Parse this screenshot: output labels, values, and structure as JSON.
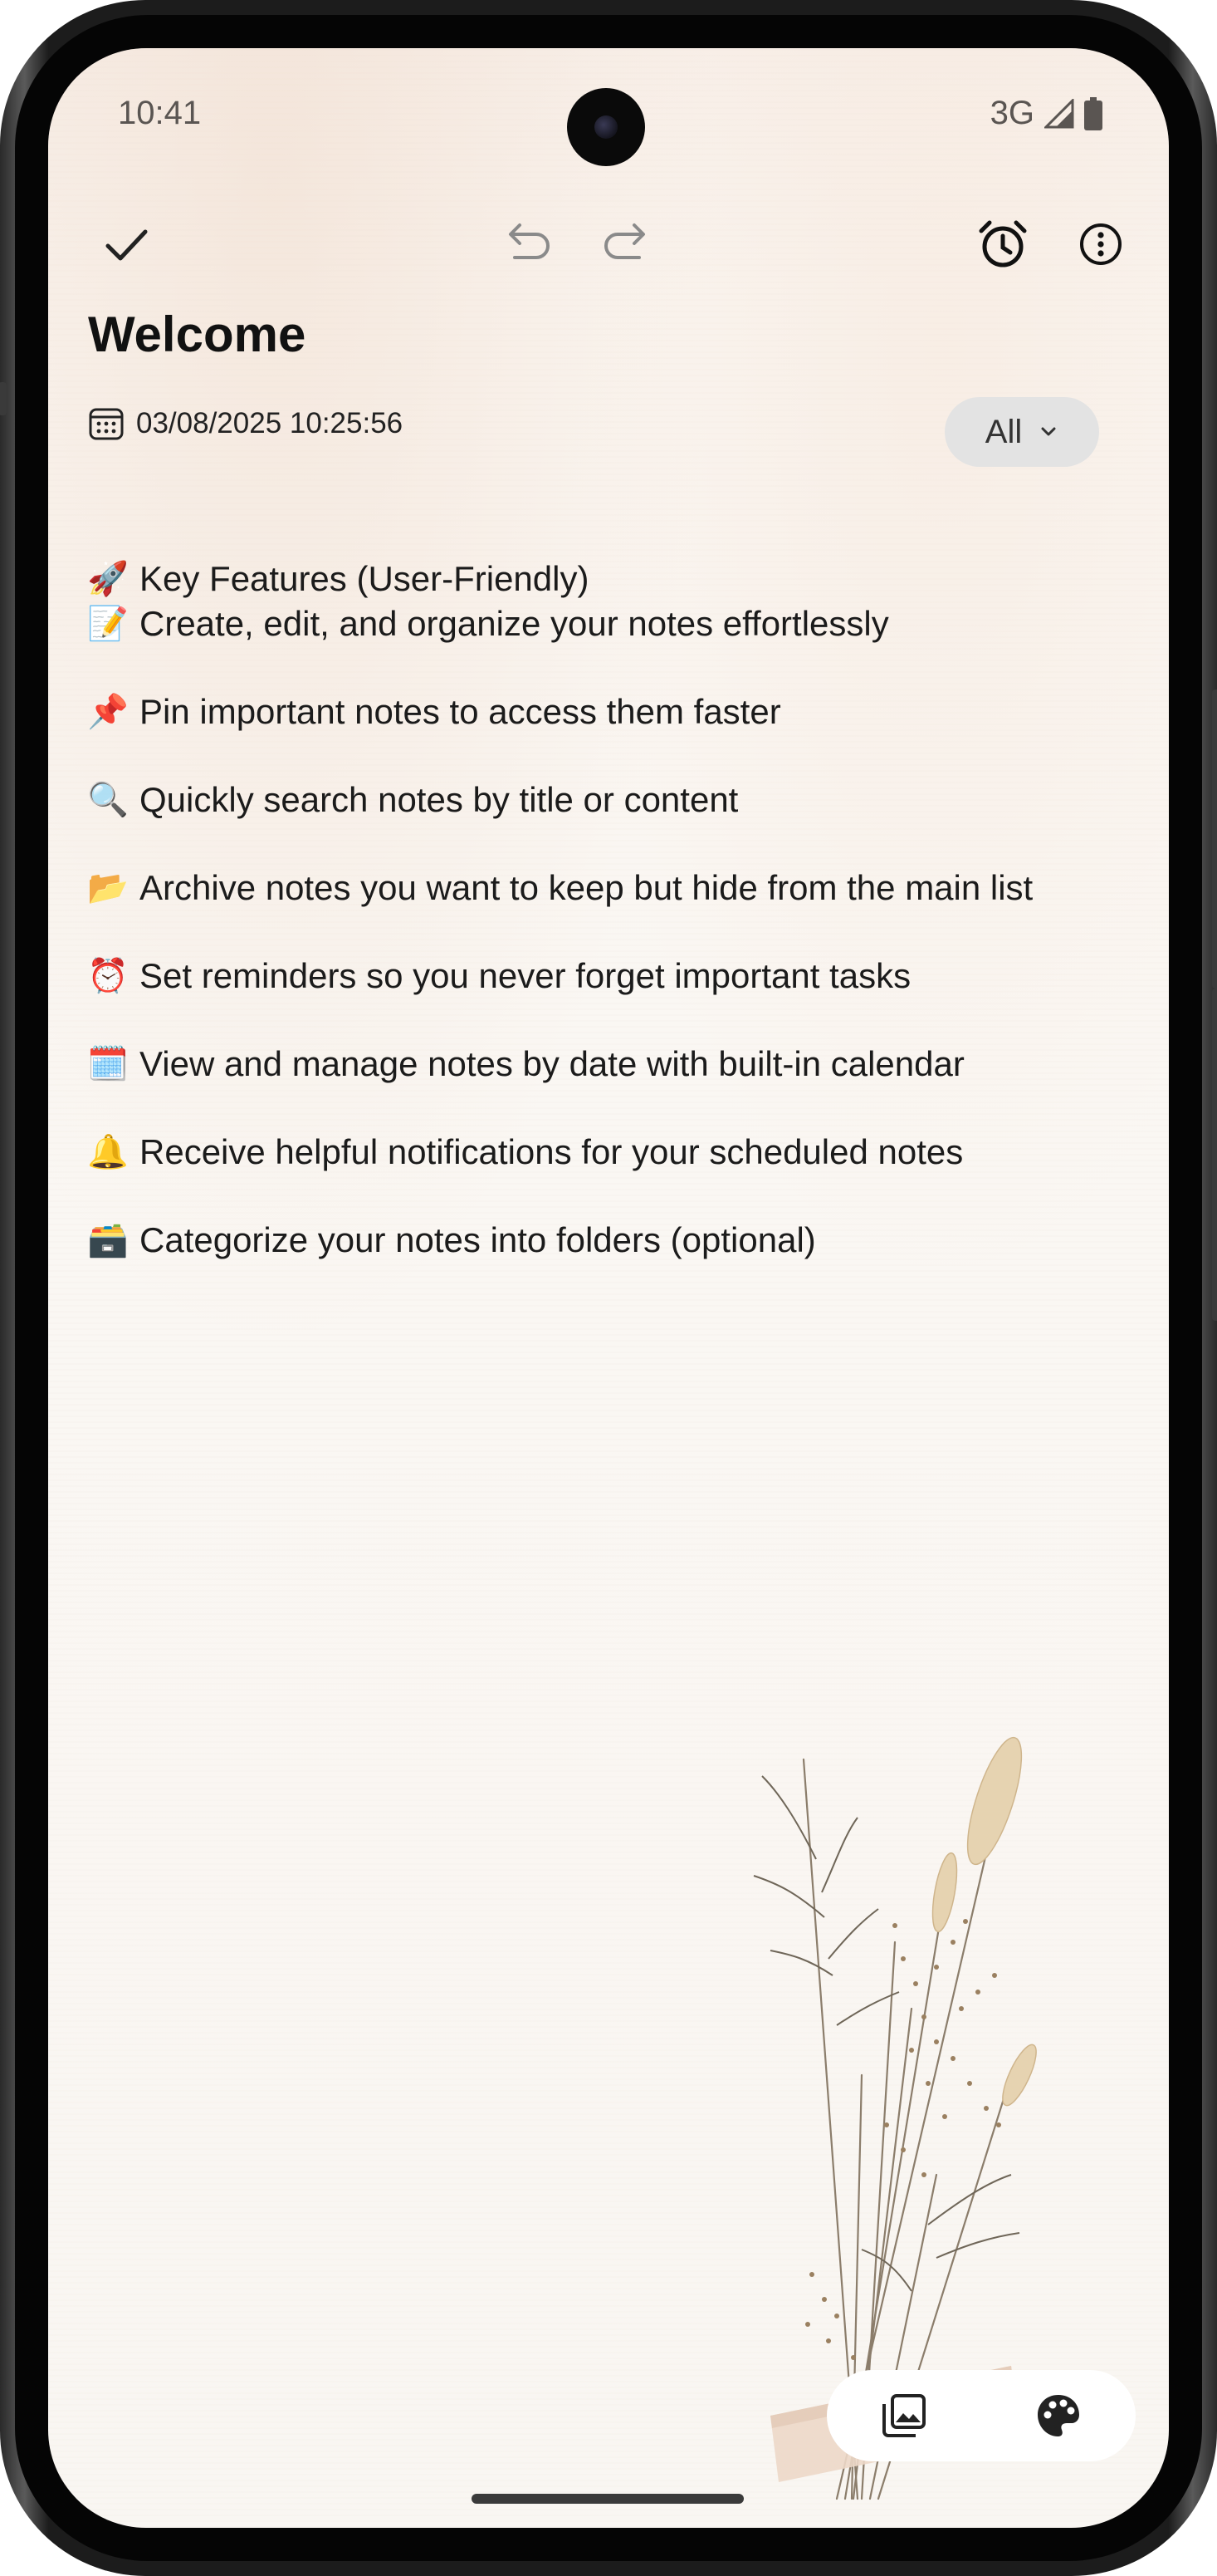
{
  "status_bar": {
    "time": "10:41",
    "network": "3G",
    "icons": [
      "signal-icon",
      "battery-icon"
    ]
  },
  "toolbar": {
    "icons": [
      "check-icon",
      "undo-icon",
      "redo-icon",
      "alarm-icon",
      "more-vertical-icon"
    ]
  },
  "note": {
    "title": "Welcome",
    "date_icon": "calendar-icon",
    "datetime": "03/08/2025 10:25:56",
    "filter": {
      "selected": "All",
      "icon": "chevron-down-icon"
    },
    "lines": [
      {
        "emoji": "🚀",
        "text": "Key Features (User-Friendly)"
      },
      {
        "emoji": "📝",
        "text": "Create, edit, and organize your notes effortlessly"
      },
      {
        "emoji": "📌",
        "text": "Pin important notes to access them faster"
      },
      {
        "emoji": "🔍",
        "text": "Quickly search notes by title or content"
      },
      {
        "emoji": "📂",
        "text": "Archive notes you want to keep but hide from the main list"
      },
      {
        "emoji": "⏰",
        "text": "Set reminders so you never forget important tasks"
      },
      {
        "emoji": "🗓️",
        "text": "View and manage notes by date with built-in calendar"
      },
      {
        "emoji": "🔔",
        "text": "Receive helpful notifications for your scheduled notes"
      },
      {
        "emoji": "🗃️",
        "text": "Categorize your notes into folders (optional)"
      }
    ]
  },
  "bottom_bar": {
    "icons": [
      "image-gallery-icon",
      "palette-icon"
    ]
  },
  "colors": {
    "paper_background": "#faf6f2",
    "text": "#1b1b1b",
    "chip_background": "#e3e3e3"
  }
}
